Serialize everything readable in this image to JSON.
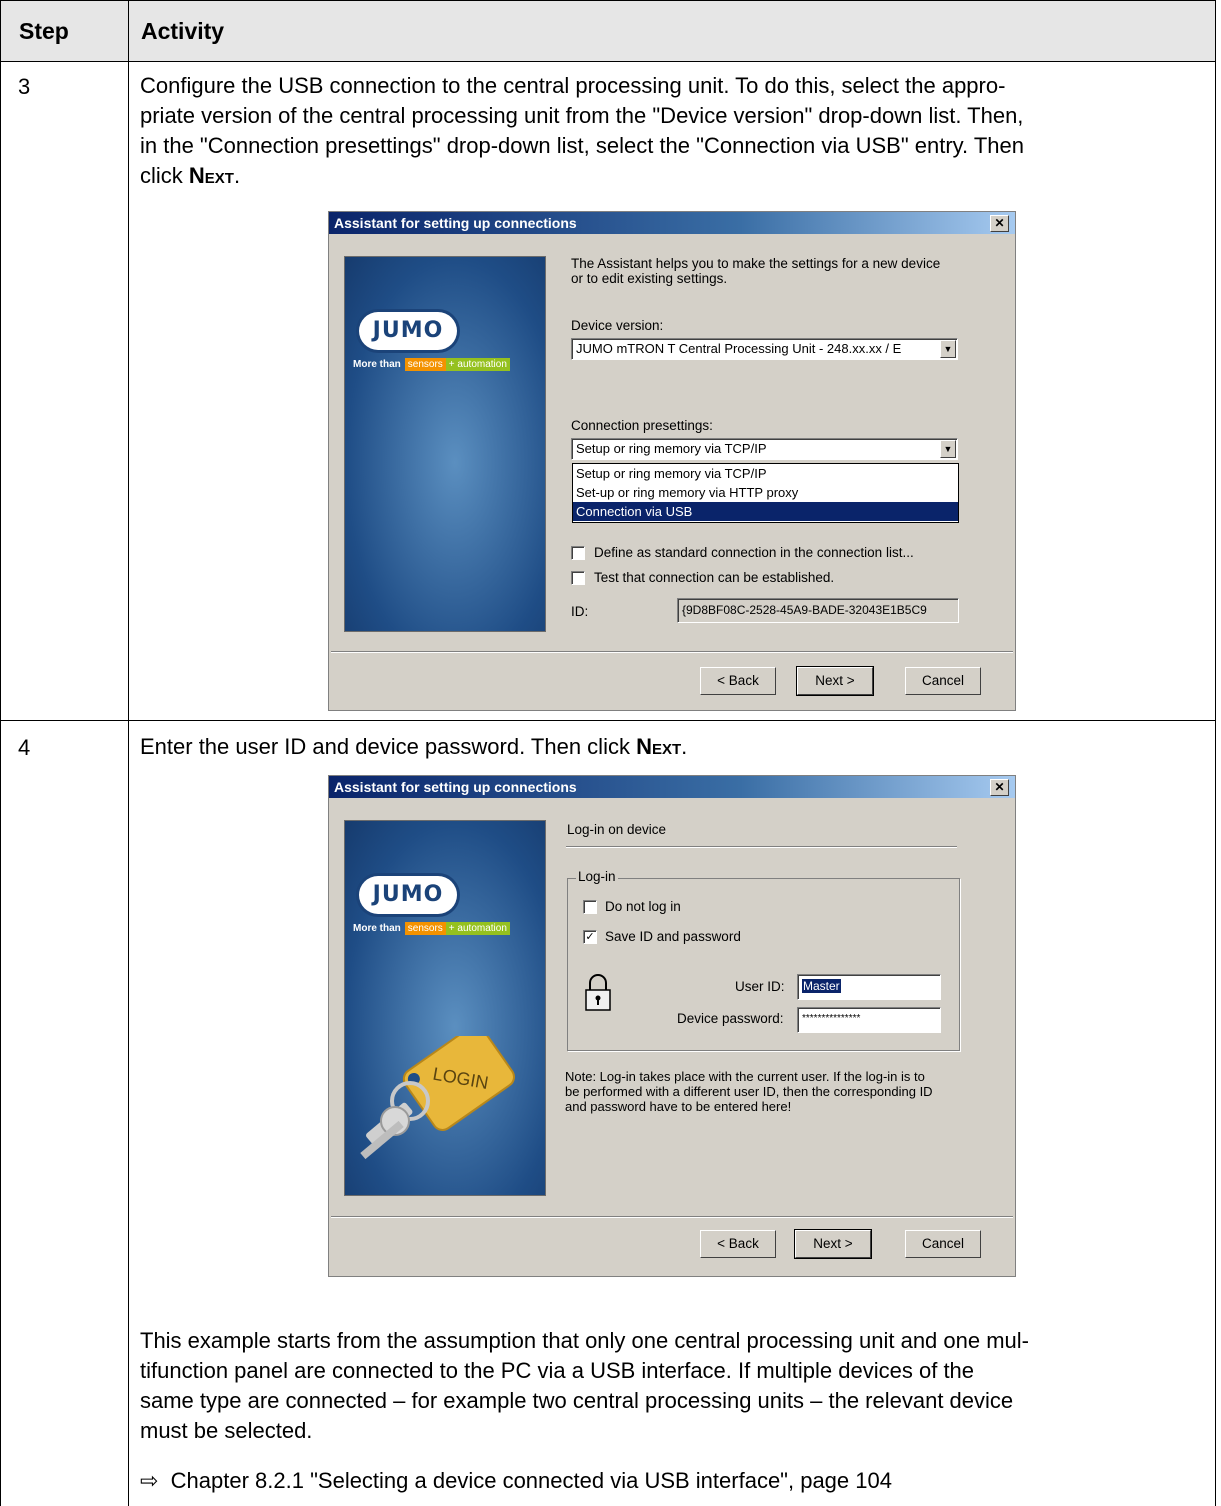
{
  "table": {
    "col_step": "Step",
    "col_activity": "Activity"
  },
  "rows": [
    {
      "step": "3",
      "text_lines": [
        "Configure the USB connection to the central processing unit. To do this, select the appro-",
        "priate version of the central processing unit from the \"Device version\" drop-down list. Then,",
        "in the \"Connection presettings\" drop-down list, select the \"Connection via USB\" entry. Then"
      ],
      "text_last_prefix": "click ",
      "text_last_key": "Next",
      "text_last_suffix": "."
    },
    {
      "step": "4",
      "text_prefix": "Enter the user ID and device password. Then click ",
      "text_key": "Next",
      "text_suffix": ".",
      "note_lines": [
        "This example starts from the assumption that only one central processing unit and one mul-",
        "tifunction panel are connected to the PC via a USB interface. If multiple devices of the",
        "same type are connected – for example two central processing units – the relevant device",
        "must be selected."
      ],
      "reference": "Chapter 8.2.1 \"Selecting a device connected via USB interface\", page 104",
      "reference_arrow": "⇨"
    }
  ],
  "dialog1": {
    "title": "Assistant for setting up connections",
    "close": "✕",
    "logo": "JUMO",
    "tag_more": "More than",
    "tag_sensors": "sensors",
    "tag_plus": "+",
    "tag_automation": "automation",
    "intro_line1": "The Assistant  helps you to make the settings for a new device",
    "intro_line2": "or to edit existing settings.",
    "device_version_label": "Device version:",
    "device_version_value": "JUMO mTRON T Central Processing Unit  -  248.xx.xx / E",
    "presettings_label": "Connection presettings:",
    "presettings_value": "Setup or ring memory via TCP/IP",
    "options": [
      "Setup or ring memory via TCP/IP",
      "Set-up or ring memory via HTTP proxy",
      "Connection via USB"
    ],
    "selected_option_index": 2,
    "check1_label": "Define as standard connection in the connection list...",
    "check2_label": "Test that connection can be established.",
    "id_label": "ID:",
    "id_value": "{9D8BF08C-2528-45A9-BADE-32043E1B5C9",
    "btn_back": "< Back",
    "btn_next": "Next >",
    "btn_cancel": "Cancel"
  },
  "dialog2": {
    "title": "Assistant for setting up connections",
    "close": "✕",
    "logo": "JUMO",
    "tag_more": "More than",
    "tag_sensors": "sensors",
    "tag_plus": "+",
    "tag_automation": "automation",
    "key_tag": "LOGIN",
    "heading": "Log-in on device",
    "group_label": "Log-in",
    "check_nologin_label": "Do not log in",
    "check_nologin": false,
    "check_save_label": "Save ID and password",
    "check_save": true,
    "user_id_label": "User ID:",
    "user_id_value": "Master",
    "password_label": "Device password:",
    "password_value": "***************",
    "note_line1": "Note: Log-in takes place with the current user. If the log-in is to",
    "note_line2": "be performed with a different user ID, then the corresponding ID",
    "note_line3": "and password have to be entered here!",
    "btn_back": "< Back",
    "btn_next": "Next >",
    "btn_cancel": "Cancel"
  }
}
